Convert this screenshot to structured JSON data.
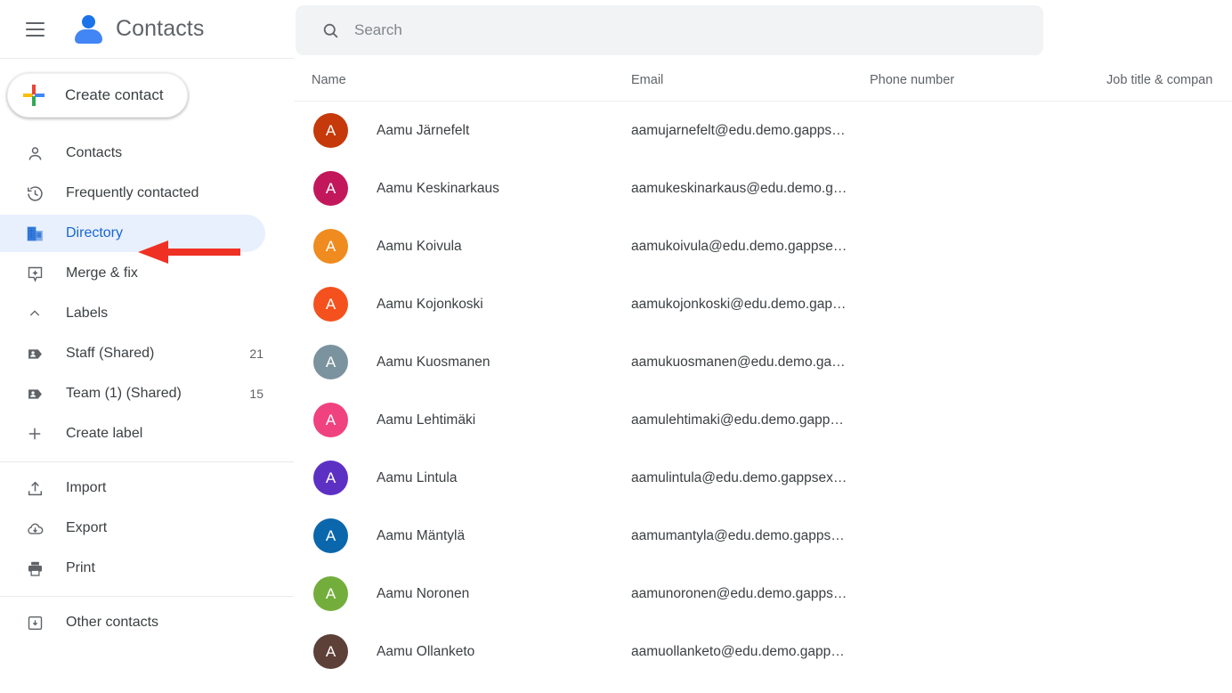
{
  "app": {
    "title": "Contacts",
    "menu_icon": "hamburger-icon",
    "logo_icon": "contacts-person-logo"
  },
  "sidebar": {
    "create_button": {
      "label": "Create contact",
      "icon": "google-plus-icon"
    },
    "nav": [
      {
        "label": "Contacts",
        "icon": "person-outline-icon",
        "active": false,
        "count": ""
      },
      {
        "label": "Frequently contacted",
        "icon": "history-clock-icon",
        "active": false,
        "count": ""
      },
      {
        "label": "Directory",
        "icon": "building-icon",
        "active": true,
        "count": ""
      },
      {
        "label": "Merge & fix",
        "icon": "merge-fix-icon",
        "active": false,
        "count": ""
      }
    ],
    "labels_section": {
      "header": "Labels",
      "chevron": "chevron-up-icon",
      "items": [
        {
          "label": "Staff (Shared)",
          "icon": "label-tag-icon",
          "count": "21"
        },
        {
          "label": "Team (1) (Shared)",
          "icon": "label-tag-icon",
          "count": "15"
        }
      ],
      "create_label": {
        "label": "Create label",
        "icon": "plus-icon"
      }
    },
    "tools": [
      {
        "label": "Import",
        "icon": "import-upload-icon"
      },
      {
        "label": "Export",
        "icon": "export-cloud-download-icon"
      },
      {
        "label": "Print",
        "icon": "printer-icon"
      }
    ],
    "other": [
      {
        "label": "Other contacts",
        "icon": "other-contacts-box-icon"
      }
    ],
    "annotation": {
      "type": "red-arrow",
      "points_to": "Directory",
      "color": "#ef3124"
    }
  },
  "search": {
    "placeholder": "Search",
    "value": "",
    "icon": "search-icon"
  },
  "table": {
    "columns": [
      "Name",
      "Email",
      "Phone number",
      "Job title & compan"
    ],
    "rows": [
      {
        "initial": "A",
        "color": "#c5390a",
        "name": "Aamu Järnefelt",
        "email": "aamujarnefelt@edu.demo.gapps…",
        "phone": "",
        "job": ""
      },
      {
        "initial": "A",
        "color": "#c2185b",
        "name": "Aamu Keskinarkaus",
        "email": "aamukeskinarkaus@edu.demo.g…",
        "phone": "",
        "job": ""
      },
      {
        "initial": "A",
        "color": "#ef8b1f",
        "name": "Aamu Koivula",
        "email": "aamukoivula@edu.demo.gappse…",
        "phone": "",
        "job": ""
      },
      {
        "initial": "A",
        "color": "#f4511e",
        "name": "Aamu Kojonkoski",
        "email": "aamukojonkoski@edu.demo.gap…",
        "phone": "",
        "job": ""
      },
      {
        "initial": "A",
        "color": "#7b939e",
        "name": "Aamu Kuosmanen",
        "email": "aamukuosmanen@edu.demo.ga…",
        "phone": "",
        "job": ""
      },
      {
        "initial": "A",
        "color": "#f0427f",
        "name": "Aamu Lehtimäki",
        "email": "aamulehtimaki@edu.demo.gapp…",
        "phone": "",
        "job": ""
      },
      {
        "initial": "A",
        "color": "#5d30c4",
        "name": "Aamu Lintula",
        "email": "aamulintula@edu.demo.gappsex…",
        "phone": "",
        "job": ""
      },
      {
        "initial": "A",
        "color": "#0b67ab",
        "name": "Aamu Mäntylä",
        "email": "aamumantyla@edu.demo.gapps…",
        "phone": "",
        "job": ""
      },
      {
        "initial": "A",
        "color": "#73ae3c",
        "name": "Aamu Noronen",
        "email": "aamunoronen@edu.demo.gapps…",
        "phone": "",
        "job": ""
      },
      {
        "initial": "A",
        "color": "#5d4037",
        "name": "Aamu Ollanketo",
        "email": "aamuollanketo@edu.demo.gapp…",
        "phone": "",
        "job": ""
      }
    ]
  },
  "colors": {
    "accent_blue": "#1a73e8",
    "active_pill": "#e8f0fe",
    "active_text": "#1967d2",
    "search_bg": "#f1f3f4",
    "text_primary": "#3c4043",
    "text_secondary": "#5f6368",
    "annotation_red": "#ef3124"
  }
}
